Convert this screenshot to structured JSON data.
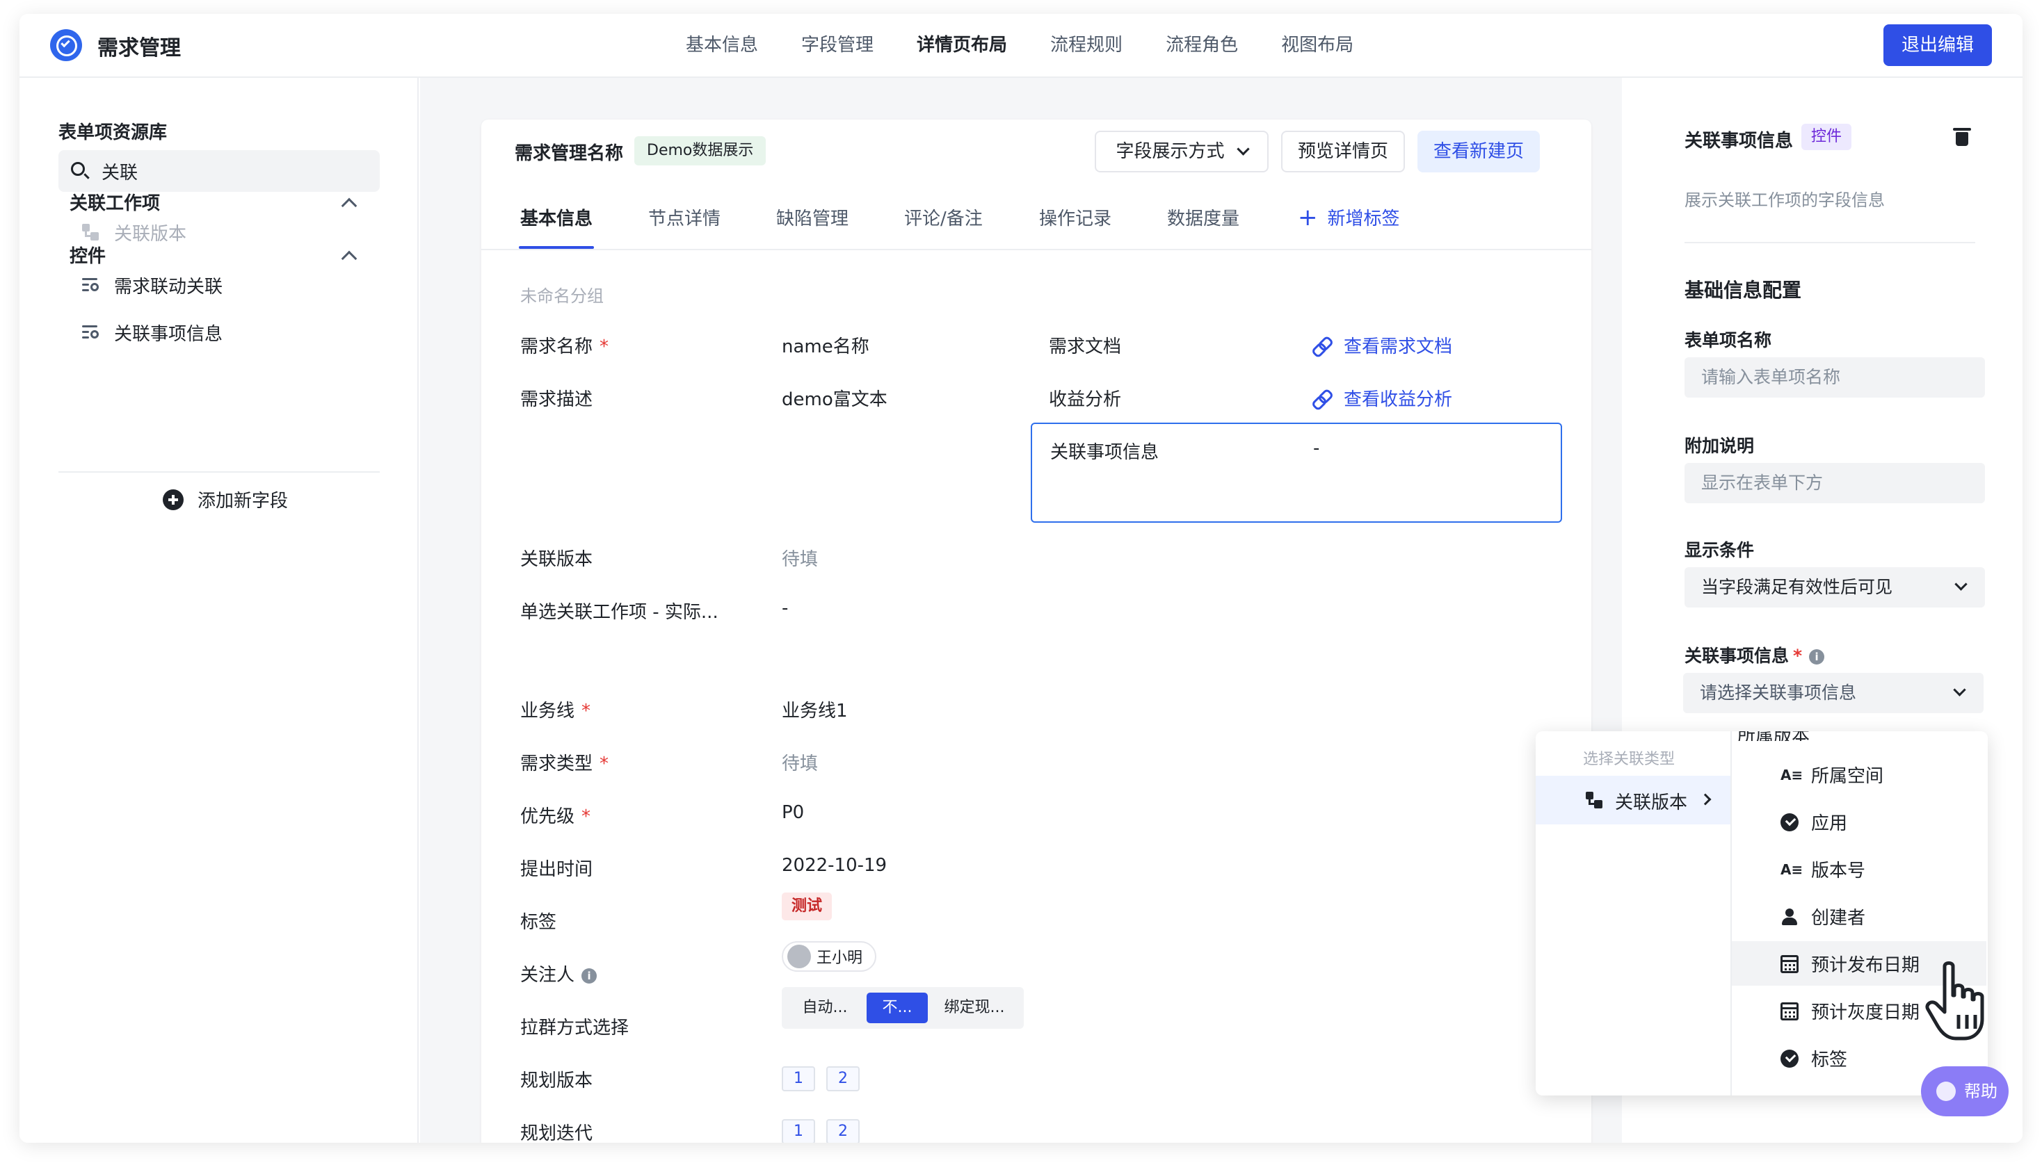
{
  "header": {
    "app_title": "需求管理",
    "nav": [
      "基本信息",
      "字段管理",
      "详情页布局",
      "流程规则",
      "流程角色",
      "视图布局"
    ],
    "active_nav": "详情页布局",
    "exit_label": "退出编辑"
  },
  "sidebar": {
    "title": "表单项资源库",
    "search_value": "关联",
    "group1": {
      "label": "关联工作项",
      "items": [
        {
          "label": "关联版本",
          "icon": "relation-version-icon",
          "disabled": true
        }
      ]
    },
    "group2": {
      "label": "控件",
      "items": [
        {
          "label": "需求联动关联",
          "icon": "control-icon"
        },
        {
          "label": "关联事项信息",
          "icon": "control-icon"
        }
      ]
    },
    "add_label": "添加新字段"
  },
  "card": {
    "title": "需求管理名称",
    "badge": "Demo数据展示",
    "display_mode_label": "字段展示方式",
    "preview_label": "预览详情页",
    "view_new_label": "查看新建页",
    "tabs": [
      "基本信息",
      "节点详情",
      "缺陷管理",
      "评论/备注",
      "操作记录",
      "数据度量"
    ],
    "add_tab_plus": "+",
    "add_tab_label": "新增标签",
    "group_title": "未命名分组",
    "fields": {
      "name": {
        "label": "需求名称",
        "value": "name名称",
        "required": "*"
      },
      "desc": {
        "label": "需求描述",
        "value": "demo富文本"
      },
      "doc": {
        "label": "需求文档",
        "link": "查看需求文档"
      },
      "benefit": {
        "label": "收益分析",
        "link": "查看收益分析"
      },
      "related_info": {
        "label": "关联事项信息",
        "value": "-"
      },
      "rel_version": {
        "label": "关联版本",
        "value": "待填"
      },
      "single_rel": {
        "label": "单选关联工作项 - 实际...",
        "value": "-"
      },
      "biz_line": {
        "label": "业务线",
        "value": "业务线1",
        "required": "*"
      },
      "req_type": {
        "label": "需求类型",
        "value": "待填",
        "required": "*"
      },
      "priority": {
        "label": "优先级",
        "value": "P0",
        "required": "*"
      },
      "submit_time": {
        "label": "提出时间",
        "value": "2022-10-19"
      },
      "tags": {
        "label": "标签",
        "value": "测试"
      },
      "watchers": {
        "label": "关注人",
        "info": "i",
        "value": "王小明"
      },
      "group_method": {
        "label": "拉群方式选择",
        "options": [
          "自动...",
          "不...",
          "绑定现..."
        ],
        "selected": "不..."
      },
      "plan_version": {
        "label": "规划版本",
        "values": [
          "1",
          "2"
        ]
      },
      "plan_iteration": {
        "label": "规划迭代",
        "values": [
          "1",
          "2"
        ]
      }
    }
  },
  "right_panel": {
    "title": "关联事项信息",
    "badge": "控件",
    "description": "展示关联工作项的字段信息",
    "section": "基础信息配置",
    "form_name_label": "表单项名称",
    "form_name_placeholder": "请输入表单项名称",
    "extra_label": "附加说明",
    "extra_placeholder": "显示在表单下方",
    "condition_label": "显示条件",
    "condition_value": "当字段满足有效性后可见",
    "related_label": "关联事项信息",
    "related_required": "*",
    "related_info": "i",
    "related_placeholder": "请选择关联事项信息"
  },
  "dropdown": {
    "header": "选择关联类型",
    "type": "关联版本",
    "cut_item": "所属版本",
    "items": [
      {
        "label": "所属空间",
        "icon": "text-icon"
      },
      {
        "label": "应用",
        "icon": "check-circle-icon"
      },
      {
        "label": "版本号",
        "icon": "text-icon"
      },
      {
        "label": "创建者",
        "icon": "user-icon"
      },
      {
        "label": "预计发布日期",
        "icon": "calendar-icon",
        "hover": true
      },
      {
        "label": "预计灰度日期",
        "icon": "calendar-icon"
      },
      {
        "label": "标签",
        "icon": "check-circle-icon"
      }
    ]
  },
  "help_label": "帮助",
  "colors": {
    "primary": "#2f4fe6",
    "selection": "#2f6fec",
    "required": "#e53935",
    "help": "#8b7cf6"
  }
}
